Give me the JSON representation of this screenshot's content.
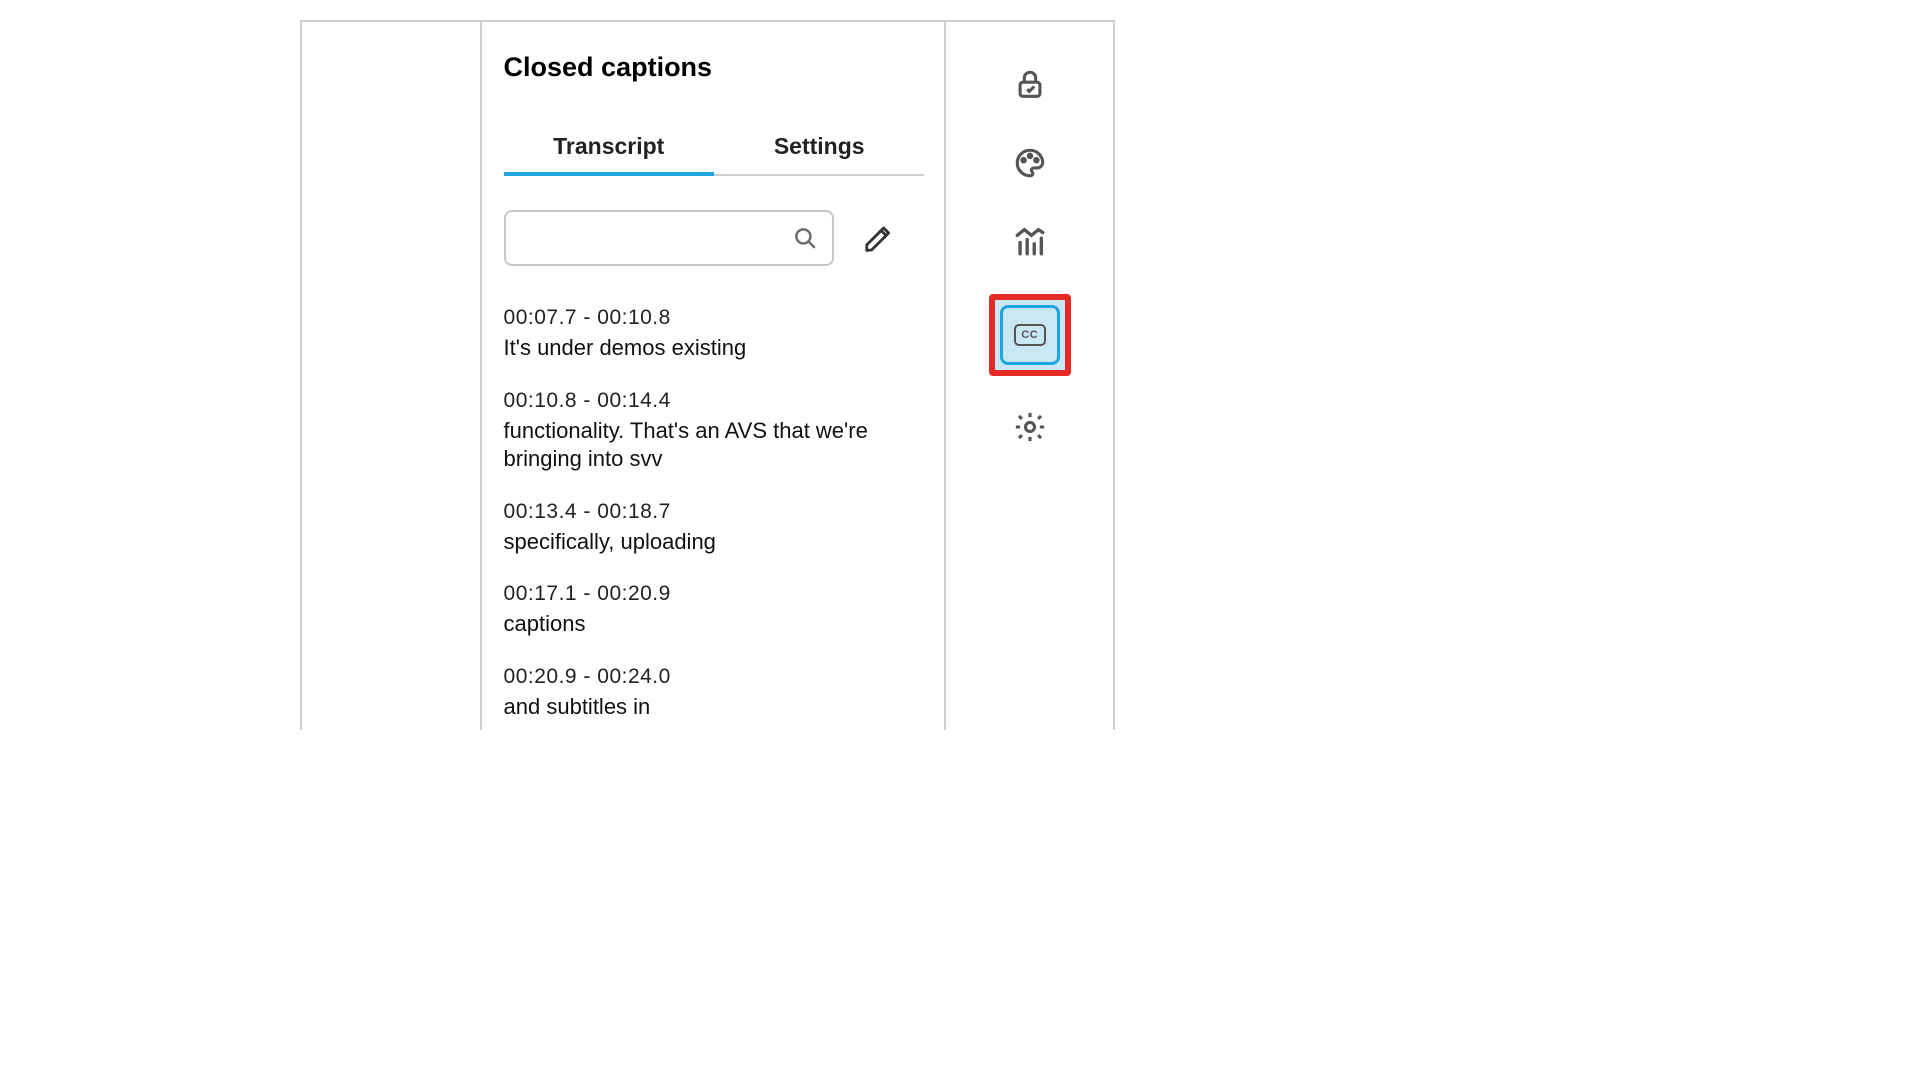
{
  "panel": {
    "title": "Closed captions",
    "tabs": [
      {
        "label": "Transcript",
        "active": true
      },
      {
        "label": "Settings",
        "active": false
      }
    ],
    "search": {
      "placeholder": ""
    },
    "entries": [
      {
        "time": "00:07.7 - 00:10.8",
        "text": "It's under demos existing"
      },
      {
        "time": "00:10.8 - 00:14.4",
        "text": "functionality. That's an AVS that we're bringing into svv"
      },
      {
        "time": "00:13.4 - 00:18.7",
        "text": "specifically, uploading"
      },
      {
        "time": "00:17.1 - 00:20.9",
        "text": "captions"
      },
      {
        "time": "00:20.9 - 00:24.0",
        "text": "and subtitles in"
      }
    ]
  },
  "sidebar": {
    "items": [
      {
        "name": "lock-icon",
        "active": false
      },
      {
        "name": "palette-icon",
        "active": false
      },
      {
        "name": "analytics-icon",
        "active": false
      },
      {
        "name": "cc-icon",
        "active": true,
        "label": "CC"
      },
      {
        "name": "settings-gear-icon",
        "active": false
      }
    ]
  },
  "annotation": {
    "highlight_color": "#e52b26",
    "active_bg": "#cae7f4",
    "active_border": "#1fa6e0"
  }
}
